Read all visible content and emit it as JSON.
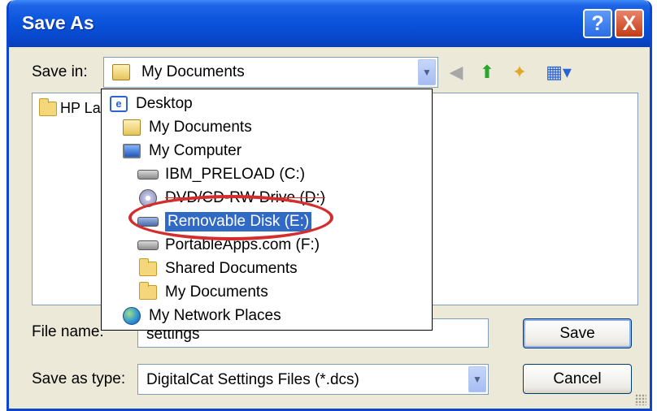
{
  "window": {
    "title": "Save As",
    "help_glyph": "?",
    "close_glyph": "X"
  },
  "save_in": {
    "label": "Save in:",
    "value": "My Documents",
    "icon": "my-documents-icon"
  },
  "toolbar": {
    "icons": [
      "back-icon",
      "up-folder-icon",
      "new-folder-icon",
      "views-menu-icon"
    ]
  },
  "file_list": {
    "items": [
      {
        "name": "HP Las",
        "icon": "folder-icon"
      }
    ]
  },
  "location_dropdown": {
    "items": [
      {
        "label": "Desktop",
        "icon": "desktop-icon",
        "level": 0,
        "selected": false
      },
      {
        "label": "My Documents",
        "icon": "my-documents-icon",
        "level": 1,
        "selected": false
      },
      {
        "label": "My Computer",
        "icon": "my-computer-icon",
        "level": 1,
        "selected": false
      },
      {
        "label": "IBM_PRELOAD (C:)",
        "icon": "hard-drive-icon",
        "level": 2,
        "selected": false
      },
      {
        "label": "DVD/CD-RW Drive (D:)",
        "icon": "optical-drive-icon",
        "level": 2,
        "selected": false
      },
      {
        "label": "Removable Disk (E:)",
        "icon": "removable-disk-icon",
        "level": 2,
        "selected": true
      },
      {
        "label": "PortableApps.com (F:)",
        "icon": "hard-drive-icon",
        "level": 2,
        "selected": false
      },
      {
        "label": "Shared Documents",
        "icon": "folder-icon",
        "level": 2,
        "selected": false
      },
      {
        "label": "My Documents",
        "icon": "folder-icon",
        "level": 2,
        "selected": false
      },
      {
        "label": "My Network Places",
        "icon": "network-places-icon",
        "level": 1,
        "selected": false
      }
    ]
  },
  "file_name": {
    "label": "File name:",
    "value": "settings"
  },
  "save_as_type": {
    "label": "Save as type:",
    "value": "DigitalCat Settings Files (*.dcs)"
  },
  "buttons": {
    "save": "Save",
    "cancel": "Cancel"
  },
  "colors": {
    "title_bar": "#0a55dc",
    "selection": "#316ac5",
    "annotation_ring": "#d42d2d"
  }
}
